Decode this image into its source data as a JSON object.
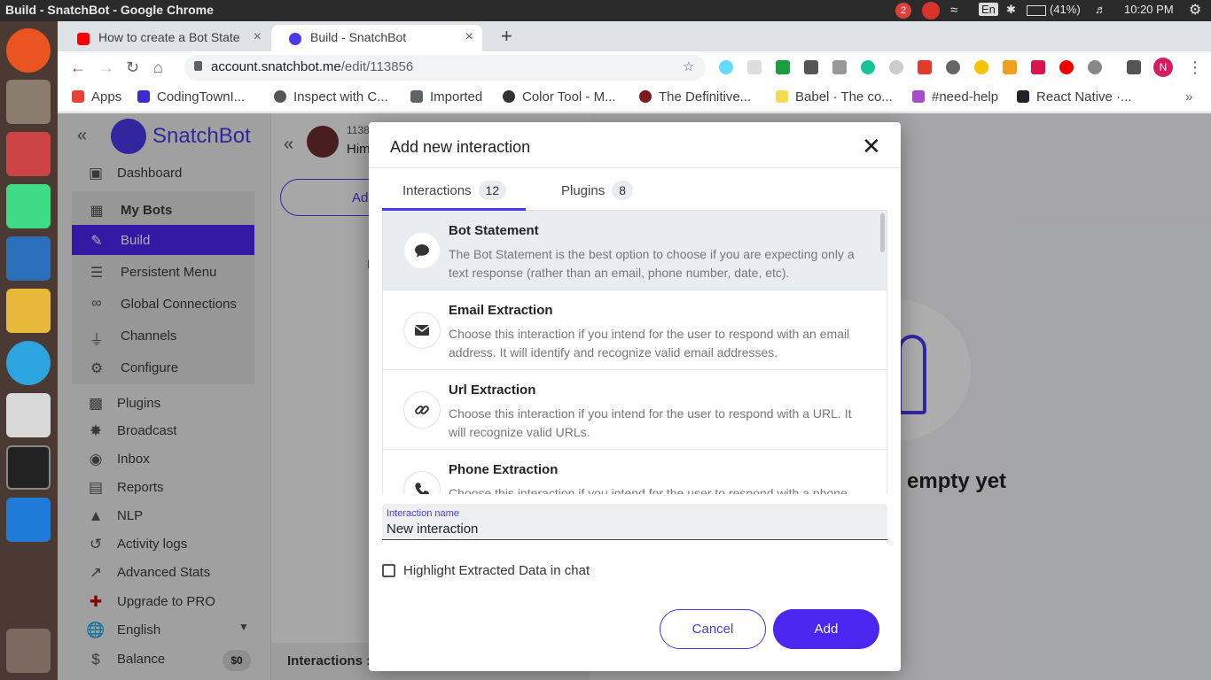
{
  "os": {
    "window_title": "Build - SnatchBot - Google Chrome",
    "lang_indicator": "En",
    "battery": "(41%)",
    "time": "10:20 PM",
    "notification_count": "2"
  },
  "browser": {
    "tabs": [
      {
        "label": "How to create a Bot State",
        "active": false
      },
      {
        "label": "Build - SnatchBot",
        "active": true
      }
    ],
    "url_host": "account.snatchbot.me",
    "url_path": "/edit/113856",
    "bookmarks": [
      "Apps",
      "CodingTownI...",
      "Inspect with C...",
      "Imported",
      "Color Tool - M...",
      "The Definitive...",
      "Babel · The co...",
      "#need-help",
      "React Native ·..."
    ],
    "profile_initial": "N"
  },
  "app": {
    "brand": "SnatchBot",
    "sidebar_group": [
      {
        "label": "Dashboard",
        "icon": "dashboard-icon"
      },
      {
        "label": "My Bots",
        "icon": "robot-icon"
      },
      {
        "label": "Build",
        "icon": "edit-icon",
        "active": true
      },
      {
        "label": "Persistent Menu",
        "icon": "menu-icon"
      },
      {
        "label": "Global Connections",
        "icon": "link-icon"
      },
      {
        "label": "Channels",
        "icon": "plug-icon"
      },
      {
        "label": "Configure",
        "icon": "gear-icon"
      }
    ],
    "sidebar_other": [
      {
        "label": "Plugins",
        "icon": "puzzle-icon"
      },
      {
        "label": "Broadcast",
        "icon": "antenna-icon"
      },
      {
        "label": "Inbox",
        "icon": "chat-icon"
      },
      {
        "label": "Reports",
        "icon": "bar-chart-icon"
      },
      {
        "label": "NLP",
        "icon": "cubes-icon"
      },
      {
        "label": "Activity logs",
        "icon": "history-icon"
      },
      {
        "label": "Advanced Stats",
        "icon": "trend-icon"
      },
      {
        "label": "Upgrade to PRO",
        "icon": "plus-circle-icon"
      },
      {
        "label": "English",
        "icon": "globe-icon"
      },
      {
        "label": "Balance",
        "icon": "dollar-icon"
      }
    ],
    "balance": "$0",
    "bot_id_partial": "1138",
    "bot_name_partial": "Him",
    "add_partial": "Add",
    "n_partial": "N",
    "interactions_footer": "Interactions :",
    "empty_text": "empty yet"
  },
  "modal": {
    "title": "Add new interaction",
    "tabs": [
      {
        "label": "Interactions",
        "count": "12"
      },
      {
        "label": "Plugins",
        "count": "8"
      }
    ],
    "items": [
      {
        "name": "Bot Statement",
        "desc": "The Bot Statement is the best option to choose if you are expecting only a text response (rather than an email, phone number, date, etc).",
        "icon": "chat-bubble-icon"
      },
      {
        "name": "Email Extraction",
        "desc": "Choose this interaction if you intend for the user to respond with an email address. It will identify and recognize valid email addresses.",
        "icon": "envelope-icon"
      },
      {
        "name": "Url Extraction",
        "desc": "Choose this interaction if you intend for the user to respond with a URL. It will recognize valid URLs.",
        "icon": "link-icon"
      },
      {
        "name": "Phone Extraction",
        "desc": "Choose this interaction if you intend for the user to respond with a phone",
        "icon": "phone-icon"
      }
    ],
    "field_label": "Interaction name",
    "field_value": "New interaction",
    "checkbox_label": "Highlight Extracted Data in chat",
    "cancel": "Cancel",
    "add": "Add"
  }
}
